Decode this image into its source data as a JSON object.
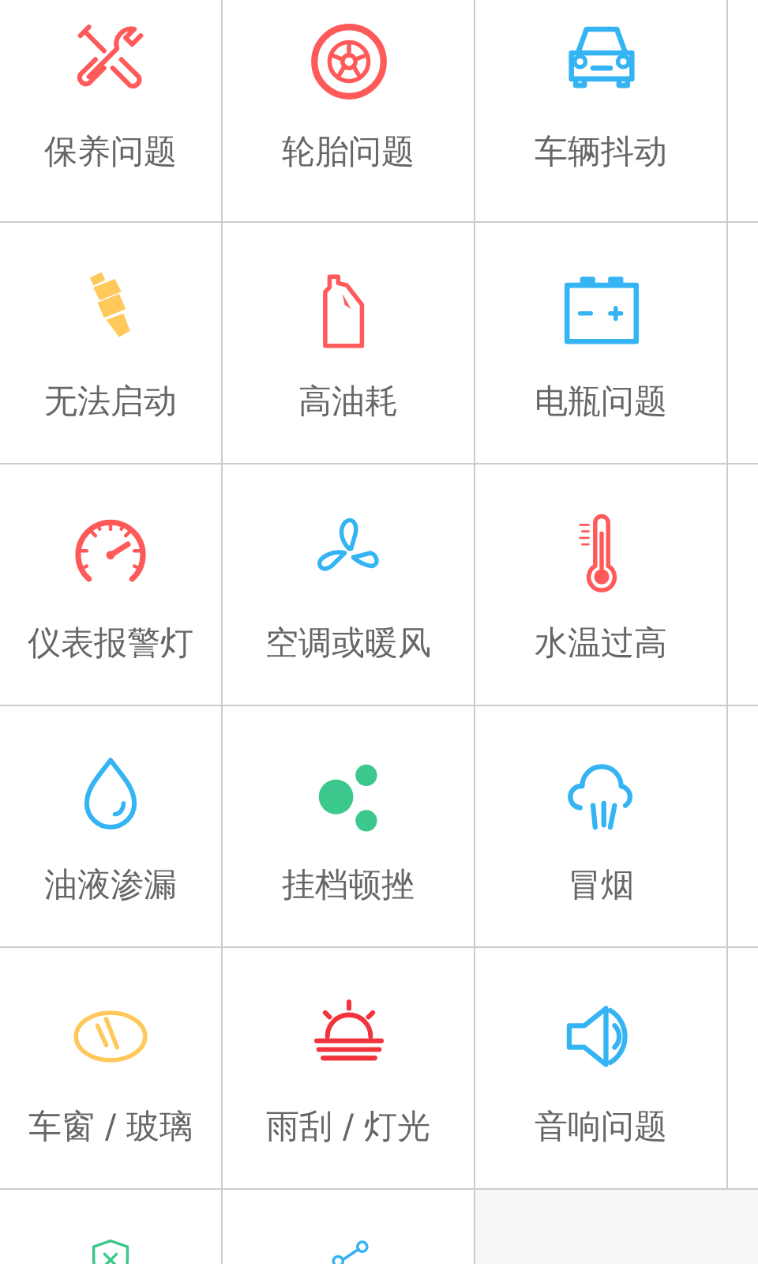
{
  "grid": [
    {
      "label": "保养问题",
      "kind": "tools",
      "color": "#ff5a5a"
    },
    {
      "label": "轮胎问题",
      "kind": "tire",
      "color": "#ff5a5a"
    },
    {
      "label": "车辆抖动",
      "kind": "car",
      "color": "#35b4f4"
    },
    {
      "label": "无法启动",
      "kind": "plug",
      "color": "#ffc85a"
    },
    {
      "label": "高油耗",
      "kind": "bottle",
      "color": "#ff5a5a"
    },
    {
      "label": "电瓶问题",
      "kind": "battery",
      "color": "#35b4f4"
    },
    {
      "label": "仪表报警灯",
      "kind": "gauge",
      "color": "#ff5a5a"
    },
    {
      "label": "空调或暖风",
      "kind": "fan",
      "color": "#35b4f4"
    },
    {
      "label": "水温过高",
      "kind": "thermometer",
      "color": "#ff5a5a"
    },
    {
      "label": "油液渗漏",
      "kind": "drop",
      "color": "#35b4f4"
    },
    {
      "label": "挂档顿挫",
      "kind": "dots",
      "color": "#3cc88c"
    },
    {
      "label": "冒烟",
      "kind": "smoke",
      "color": "#35b4f4"
    },
    {
      "label": "车窗 / 玻璃",
      "kind": "glass",
      "color": "#ffc85a"
    },
    {
      "label": "雨刮 / 灯光",
      "kind": "sunrise",
      "color": "#f0333c"
    },
    {
      "label": "音响问题",
      "kind": "speaker",
      "color": "#35b4f4"
    },
    {
      "kind": "shield",
      "color": "#3cc88c"
    },
    {
      "kind": "share",
      "color": "#35b4f4"
    }
  ]
}
